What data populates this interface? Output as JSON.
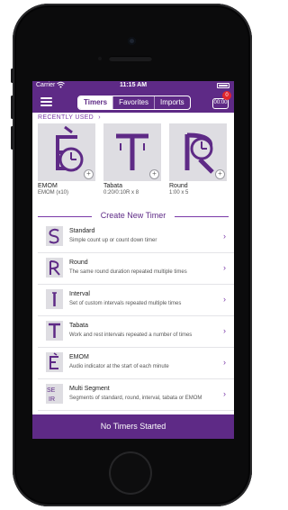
{
  "status_bar": {
    "carrier": "Carrier",
    "time": "11:15 AM"
  },
  "nav": {
    "tabs": [
      {
        "label": "Timers",
        "active": true
      },
      {
        "label": "Favorites",
        "active": false
      },
      {
        "label": "Imports",
        "active": false
      }
    ],
    "timer_badge": "0",
    "timer_icon_text": "00:00"
  },
  "recent": {
    "heading": "RECENTLY USED",
    "heading_chevron": "›",
    "items": [
      {
        "name": "EMOM",
        "detail": "EMOM (x10)",
        "letter": "E"
      },
      {
        "name": "Tabata",
        "detail": "0:20/0:10R x 8",
        "letter": "T"
      },
      {
        "name": "Round",
        "detail": "1:00 x 5",
        "letter": "R"
      }
    ]
  },
  "create": {
    "heading": "Create New Timer",
    "items": [
      {
        "title": "Standard",
        "desc": "Simple count up or count down timer",
        "letter": "S"
      },
      {
        "title": "Round",
        "desc": "The same round duration repeated multiple times",
        "letter": "R"
      },
      {
        "title": "Interval",
        "desc": "Set of custom intervals repeated multiple times",
        "letter": "I"
      },
      {
        "title": "Tabata",
        "desc": "Work and rest intervals repeated a number of times",
        "letter": "T"
      },
      {
        "title": "EMOM",
        "desc": "Audio indicator at the start of each minute",
        "letter": "E"
      },
      {
        "title": "Multi Segment",
        "desc": "Segments of standard, round, interval, tabata or EMOM",
        "letter": "SEIR"
      }
    ]
  },
  "bottom_bar": {
    "label": "No Timers Started"
  },
  "colors": {
    "brand": "#5e2a86",
    "accent": "#7a3aa8",
    "badge": "#e0252c"
  }
}
